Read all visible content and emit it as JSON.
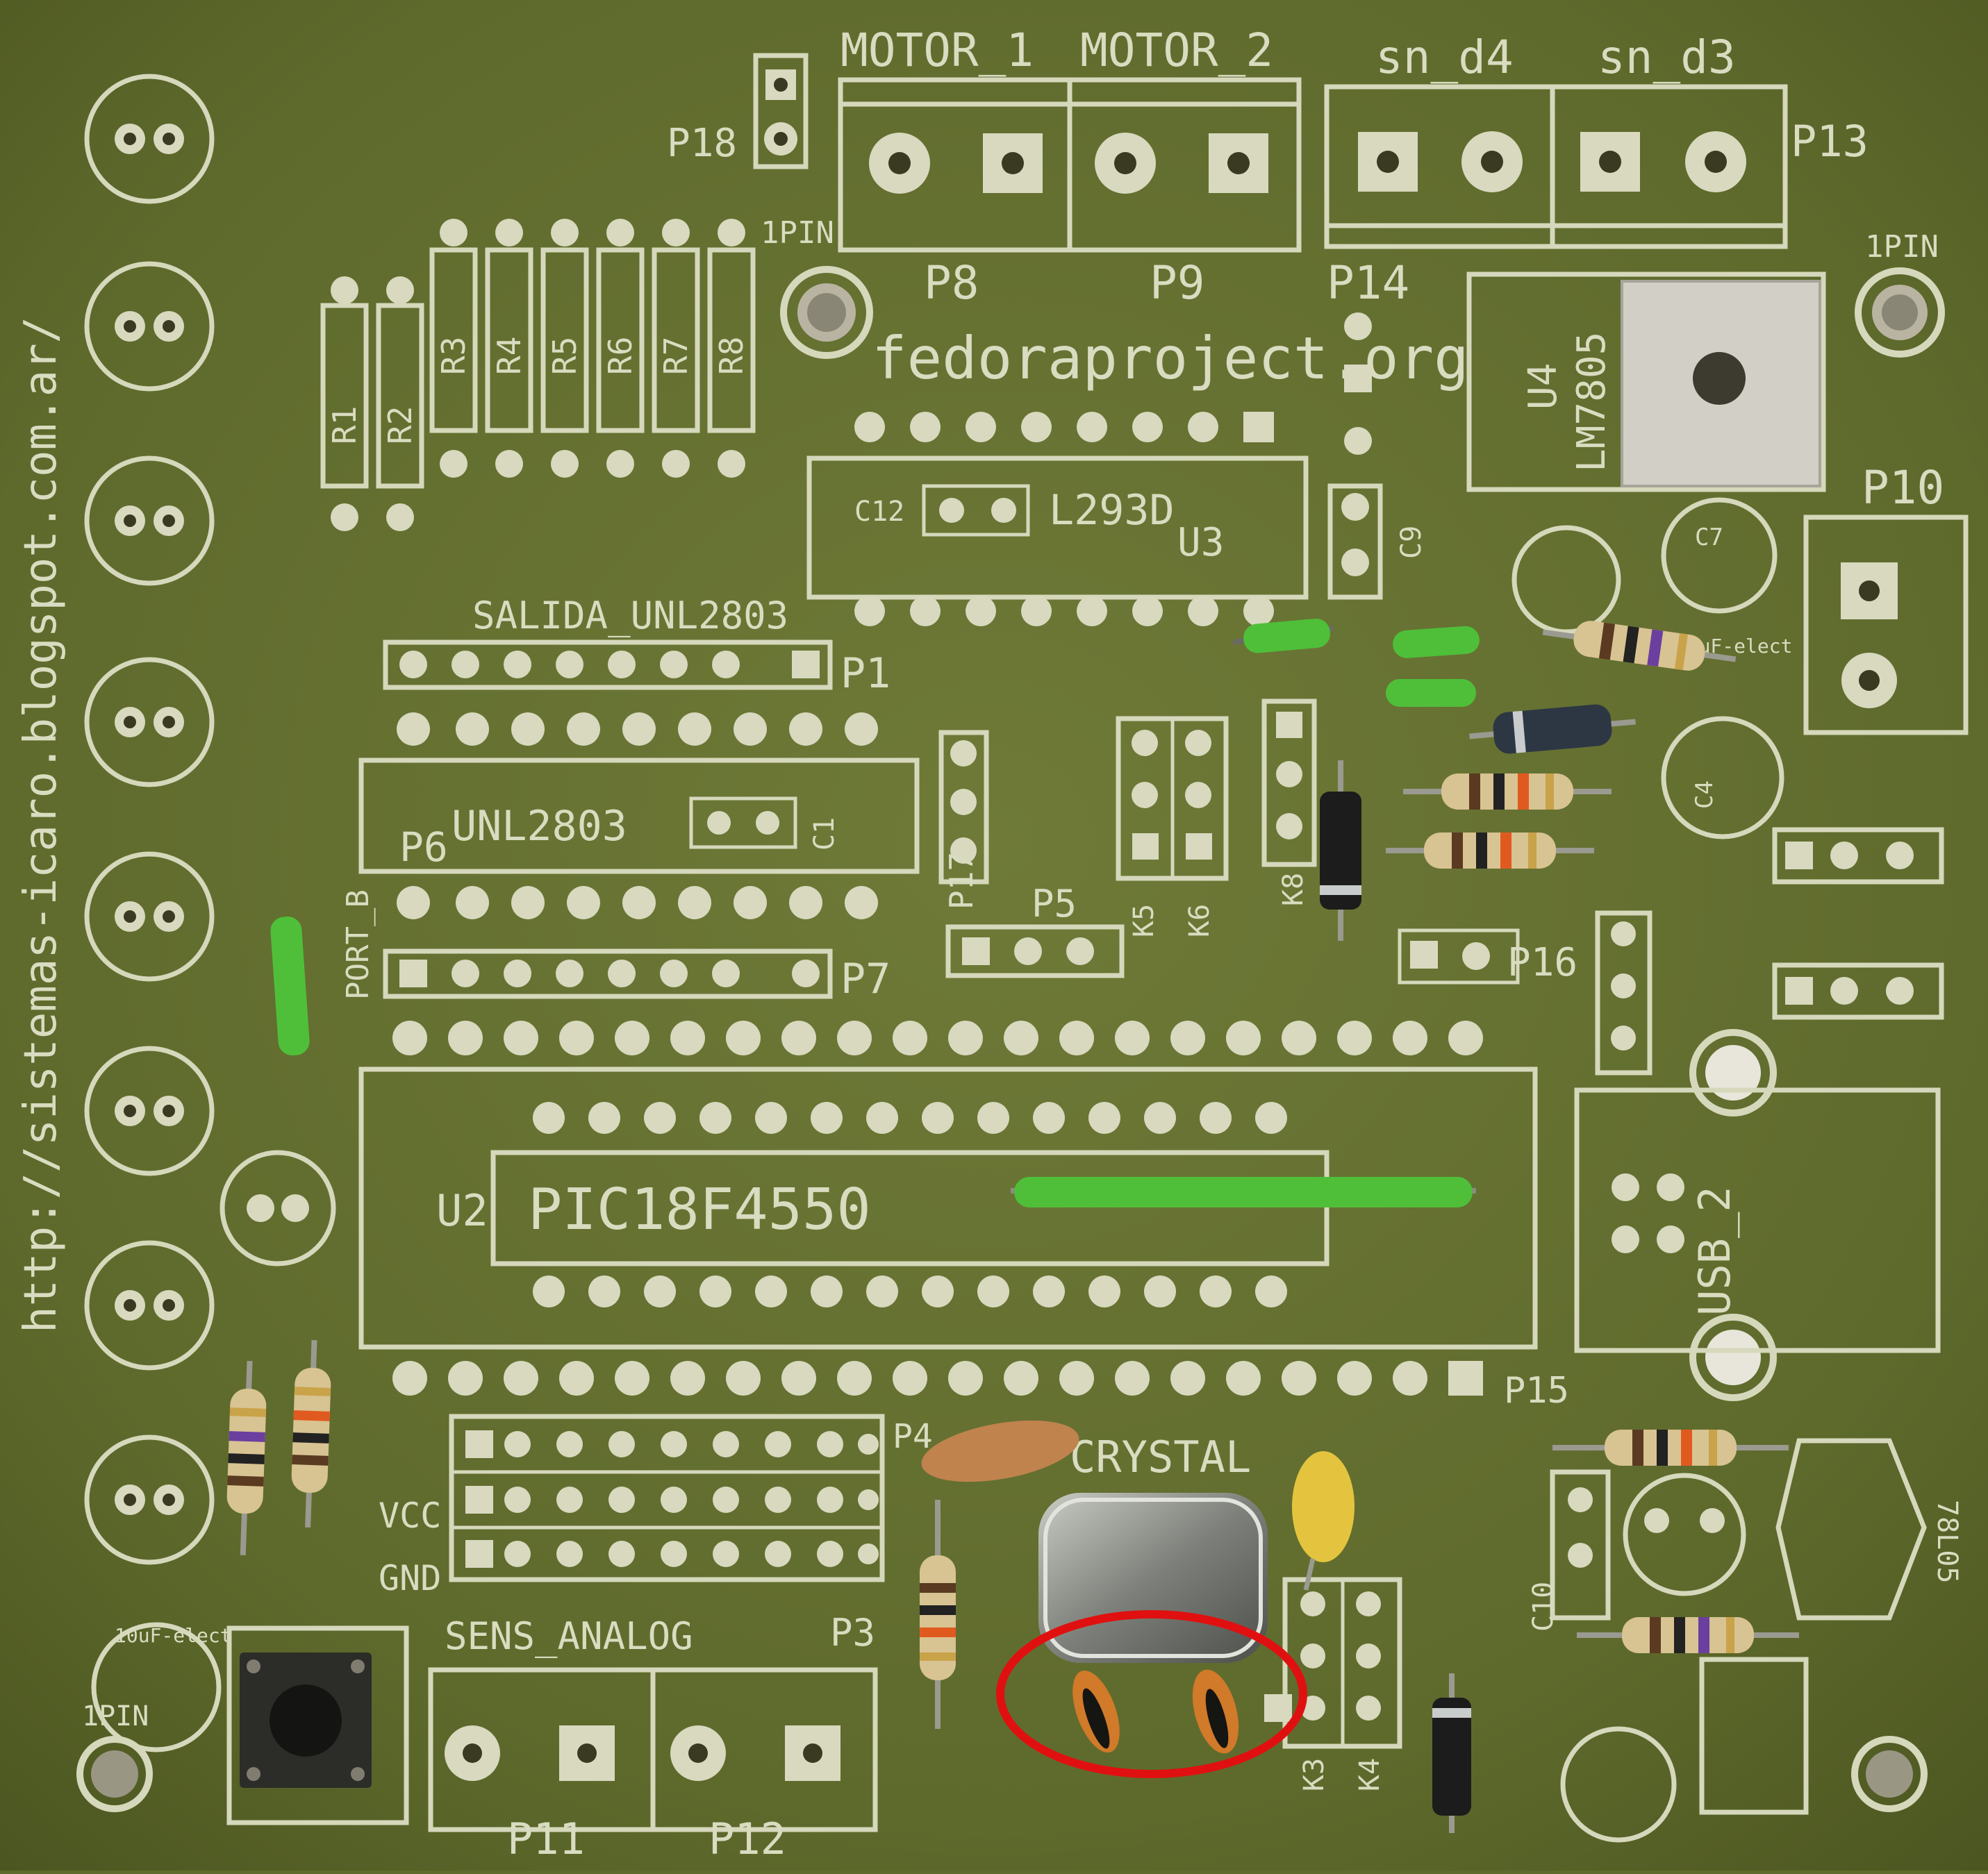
{
  "labels": {
    "motor1": "MOTOR_1",
    "motor2": "MOTOR_2",
    "sn_d4": "sn_d4",
    "sn_d3": "sn_d3",
    "p13": "P13",
    "p18": "P18",
    "onepin_top": "1PIN",
    "onepin_right": "1PIN",
    "onepin_bl": "1PIN",
    "p8": "P8",
    "p9": "P9",
    "p14": "P14",
    "website": "fedoraproject.org",
    "u4": "U4",
    "lm7805": "LM7805",
    "p10": "P10",
    "r1": "R1",
    "r2": "R2",
    "r3": "R3",
    "r4": "R4",
    "r5": "R5",
    "r6": "R6",
    "r7": "R7",
    "r8": "R8",
    "c12": "C12",
    "l293d": "L293D",
    "u3": "U3",
    "c9": "C9",
    "c7": "C7",
    "c7_value": "100uF-elect",
    "c4": "C4",
    "salida": "SALIDA_UNL2803",
    "p1": "P1",
    "p6": "P6",
    "unl2803": "UNL2803",
    "c1": "C1",
    "p17": "P17",
    "p5": "P5",
    "k5": "K5",
    "k6": "K6",
    "k8": "K8",
    "p7": "P7",
    "port_b": "PORT_B",
    "p16": "P16",
    "u2": "U2",
    "pic": "PIC18F4550",
    "usb": "USB_2",
    "p15": "P15",
    "p4": "P4",
    "crystal": "CRYSTAL",
    "vcc": "VCC",
    "gnd": "GND",
    "sens_analog": "SENS_ANALOG",
    "p3": "P3",
    "c10": "C10",
    "c5_value": "10uF-elect",
    "p11": "P11",
    "p12": "P12",
    "k3": "K3",
    "k4": "K4",
    "reg78": "78L05",
    "blog": "http://sistemas-icaro.blogspot.com.ar/"
  },
  "colors": {
    "board": "#5f6b2c",
    "silkscreen": "#d6d8bc",
    "wire": "#4fbf3a",
    "highlight": "#e01010"
  }
}
